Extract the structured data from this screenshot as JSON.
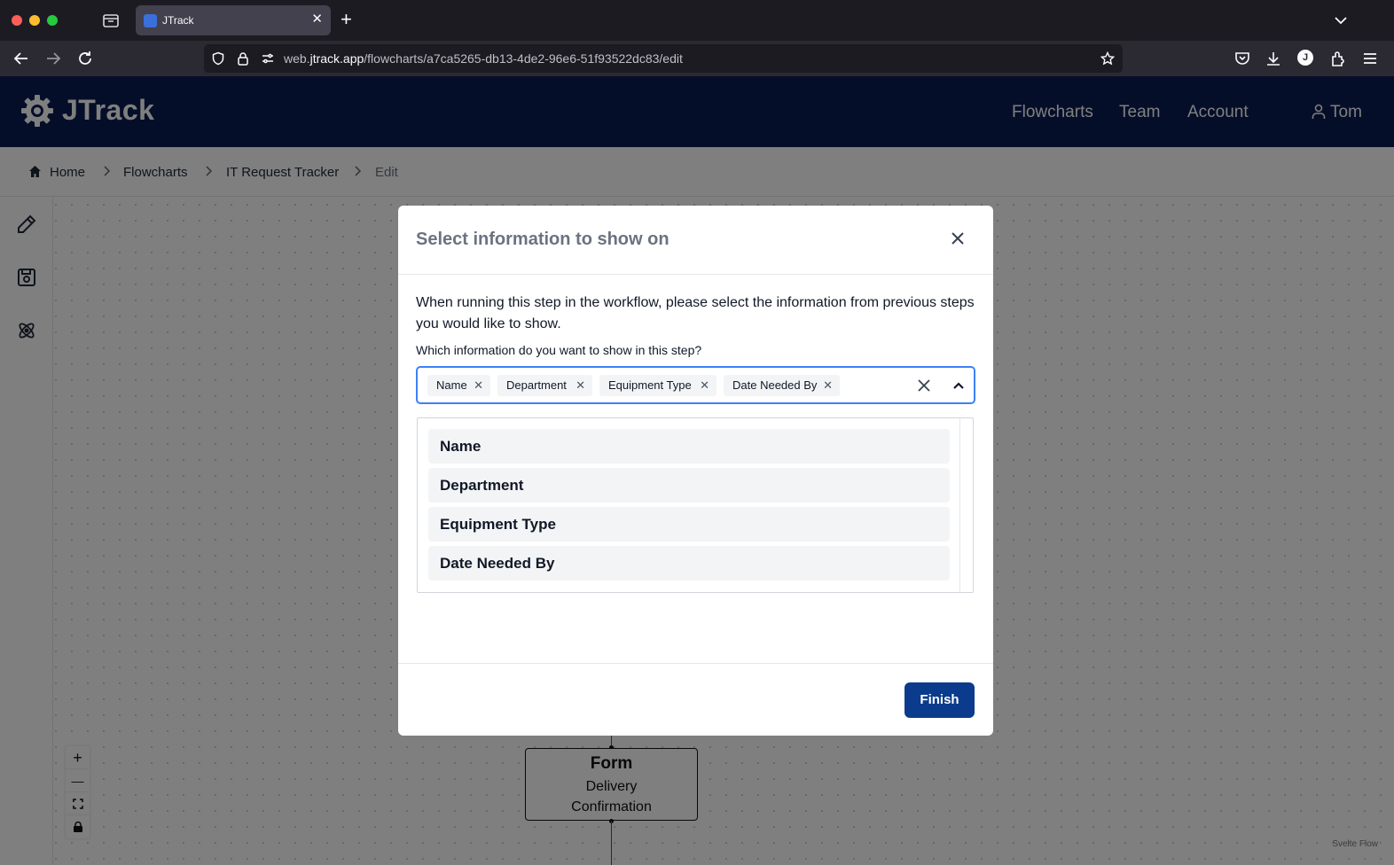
{
  "browser": {
    "tab_title": "JTrack",
    "url_prefix": "web.",
    "url_domain": "jtrack.app",
    "url_path": "/flowcharts/a7ca5265-db13-4de2-96e6-51f93522dc83/edit",
    "profile_initial": "J"
  },
  "header": {
    "brand": "JTrack",
    "nav": [
      "Flowcharts",
      "Team",
      "Account"
    ],
    "user": "Tom",
    "brand_color": "#0b1d52"
  },
  "breadcrumb": [
    "Home",
    "Flowcharts",
    "IT Request Tracker",
    "Edit"
  ],
  "side_toolbar": [
    "pencil-icon",
    "save-icon",
    "atom-icon"
  ],
  "flow_node": {
    "type": "Form",
    "label_line1": "Delivery",
    "label_line2": "Confirmation"
  },
  "zoom_controls": [
    "+",
    "—",
    "fit-view-icon",
    "lock-icon"
  ],
  "attribution": "Svelte Flow",
  "modal": {
    "title": "Select information to show on",
    "description": "When running this step in the workflow, please select the information from previous steps you would like to show.",
    "field_label": "Which information do you want to show in this step?",
    "selected": [
      "Name",
      "Department",
      "Equipment Type",
      "Date Needed By"
    ],
    "options": [
      "Name",
      "Department",
      "Equipment Type",
      "Date Needed By"
    ],
    "finish_label": "Finish",
    "accent_color": "#0b3b8c"
  }
}
